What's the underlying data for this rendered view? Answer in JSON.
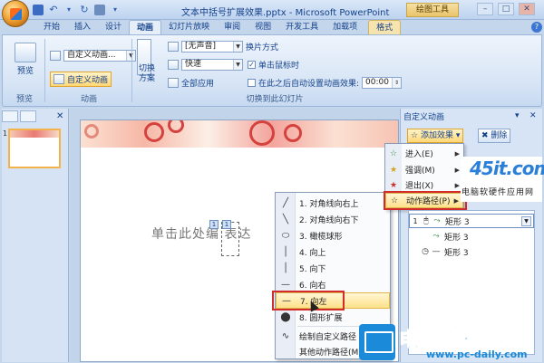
{
  "titlebar": {
    "title": "文本中括号扩展效果.pptx - Microsoft PowerPoint",
    "context_tool": "绘图工具",
    "min_label": "–",
    "max_label": "□",
    "close_label": "✕"
  },
  "tabs": [
    {
      "label": "开始"
    },
    {
      "label": "插入"
    },
    {
      "label": "设计"
    },
    {
      "label": "动画"
    },
    {
      "label": "幻灯片放映"
    },
    {
      "label": "审阅"
    },
    {
      "label": "视图"
    },
    {
      "label": "开发工具"
    },
    {
      "label": "加载项"
    },
    {
      "label": "格式"
    }
  ],
  "ribbon": {
    "preview": {
      "button": "预览",
      "group": "预览"
    },
    "animation": {
      "combo_value": "自定义动画...",
      "custom_button": "自定义动画",
      "group": "动画"
    },
    "transition": {
      "scheme_button": "切换\n方案",
      "sound_value": "[无声音]",
      "speed_value": "快速",
      "apply_all": "全部应用",
      "group": "切换到此幻灯片"
    },
    "advance": {
      "title": "换片方式",
      "on_click": "单击鼠标时",
      "after_time": "在此之后自动设置动画效果:",
      "time_value": "00:00"
    }
  },
  "slide": {
    "number": "1",
    "placeholder_text": "单击此处编  表达",
    "anim_tags": [
      "1",
      "1"
    ]
  },
  "path_menu": {
    "items": [
      {
        "icon": "╱",
        "label": "1. 对角线向右上"
      },
      {
        "icon": "╲",
        "label": "2. 对角线向右下"
      },
      {
        "icon": "⬭",
        "label": "3. 橄榄球形"
      },
      {
        "icon": "│",
        "label": "4. 向上"
      },
      {
        "icon": "│",
        "label": "5. 向下"
      },
      {
        "icon": "—",
        "label": "6. 向右"
      },
      {
        "icon": "—",
        "label": "7. 向左"
      },
      {
        "icon": "⬤",
        "label": "8. 圆形扩展"
      },
      {
        "icon": "∿",
        "label": "绘制自定义路径"
      },
      {
        "icon": "",
        "label": "其他动作路径(M)..."
      }
    ],
    "highlighted_index": 6
  },
  "taskpane": {
    "title": "自定义动画",
    "add_effect": "添加效果",
    "remove": "删除",
    "submenu": [
      {
        "icon": "☆",
        "label": "进入(E)"
      },
      {
        "icon": "★",
        "label": "强调(M)"
      },
      {
        "icon": "★",
        "label": "退出(X)"
      },
      {
        "icon": "☆",
        "label": "动作路径(P)"
      }
    ],
    "submenu_highlighted": 3,
    "list": [
      {
        "num": "1",
        "icon": "🖱",
        "label": "矩形 3"
      },
      {
        "num": "",
        "icon": "",
        "label": "矩形 3"
      },
      {
        "num": "",
        "icon": "◷",
        "label": "矩形 3"
      }
    ]
  },
  "logo": {
    "main": "45it.com",
    "sub": "电脑软硬件应用网"
  },
  "watermark": {
    "text": "电脑百科知识",
    "url": "www.pc-daily.com"
  }
}
